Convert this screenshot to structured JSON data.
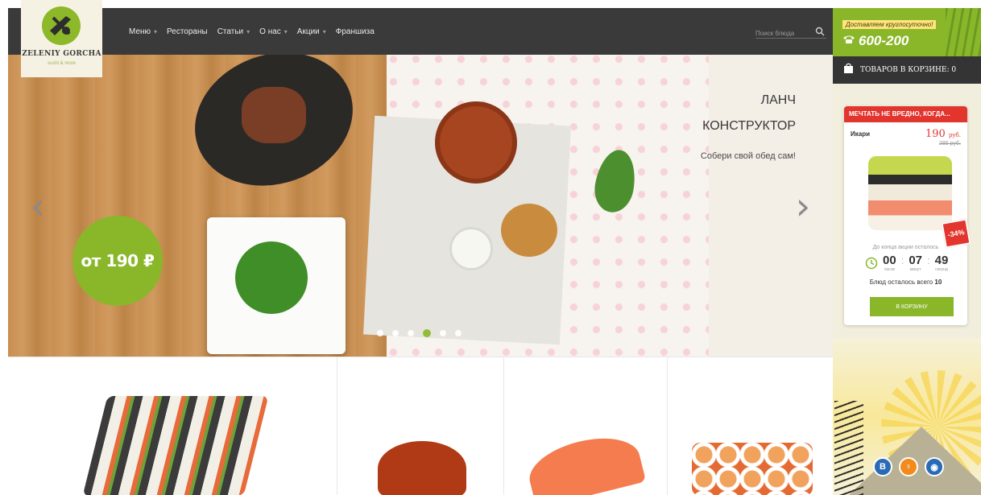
{
  "brand": {
    "name": "ZELENIY GORCHA",
    "tagline": "sushi & more"
  },
  "nav": {
    "items": [
      {
        "label": "Меню",
        "has_dropdown": true
      },
      {
        "label": "Рестораны",
        "has_dropdown": false
      },
      {
        "label": "Статьи",
        "has_dropdown": true
      },
      {
        "label": "О нас",
        "has_dropdown": true
      },
      {
        "label": "Акции",
        "has_dropdown": true
      },
      {
        "label": "Франшиза",
        "has_dropdown": false
      }
    ]
  },
  "search": {
    "placeholder": "Поиск блюда",
    "value": ""
  },
  "hero": {
    "price_badge": "от 190 ₽",
    "title_line1": "ЛАНЧ",
    "title_line2": "КОНСТРУКТОР",
    "subtitle": "Собери свой обед сам!",
    "prev_arrow": "‹",
    "next_arrow": "›",
    "dots_count": 6,
    "active_dot": 3
  },
  "sidebar": {
    "delivery_tag": "Доставляем круглосуточно!",
    "phone": "600-200",
    "cart_label": "ТОВАРОВ В КОРЗИНЕ: 0",
    "promo": {
      "header": "МЕЧТАТЬ НЕ ВРЕДНО, КОГДА...",
      "name": "Икари",
      "price": "190",
      "currency": "руб.",
      "old_price": "285 руб.",
      "discount": "-34%",
      "timer_label": "До конца акции осталось",
      "hours": "00",
      "hours_label": "часов",
      "minutes": "07",
      "minutes_label": "минут",
      "seconds": "49",
      "seconds_label": "секунд",
      "remaining_text": "Блюд осталось всего",
      "remaining_count": "10",
      "button_label": "В КОРЗИНУ"
    },
    "socials": [
      {
        "name": "vk",
        "glyph": "В"
      },
      {
        "name": "odnoklassniki",
        "glyph": "♀"
      },
      {
        "name": "instagram",
        "glyph": "◉"
      }
    ]
  },
  "colors": {
    "accent_green": "#8ab72a",
    "header_dark": "#3a3a3a",
    "promo_red": "#e2352e"
  }
}
